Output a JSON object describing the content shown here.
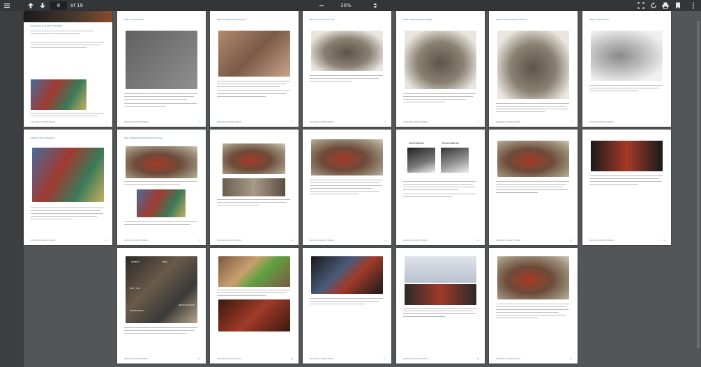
{
  "toolbar": {
    "page_input": "8",
    "page_total": "of 19",
    "zoom": "30%"
  },
  "pages": [
    {
      "title": "Dinosaurs & Creature Painting",
      "footer_left": "CREATURE CONCEPT DESIGN",
      "footer_right": "1"
    },
    {
      "title": "Step 2 Thumbnails",
      "footer_left": "CREATURE CONCEPT DESIGN",
      "footer_right": "2"
    },
    {
      "title": "Step 3 Refining Thumbnails",
      "footer_left": "CREATURE CONCEPT DESIGN",
      "footer_right": "3"
    },
    {
      "title": "Step 4 Choosing a Look",
      "footer_left": "CREATURE CONCEPT DESIGN",
      "footer_right": "4"
    },
    {
      "title": "Step 5 Exploring the Design",
      "footer_left": "CREATURE CONCEPT DESIGN",
      "footer_right": "5"
    },
    {
      "title": "Step 6 Exploring the Anatomy",
      "footer_left": "CREATURE CONCEPT DESIGN",
      "footer_right": "6"
    },
    {
      "title": "Step 7 Other Views",
      "footer_left": "CREATURE CONCEPT DESIGN",
      "footer_right": "7"
    },
    {
      "title": "Step 8 Color Variations",
      "footer_left": "CREATURE CONCEPT DESIGN",
      "footer_right": "8"
    },
    {
      "title": "Step 10 Rendering the Final Concept",
      "footer_left": "CREATURE CONCEPT DESIGN",
      "footer_right": "9"
    },
    {
      "title": "",
      "footer_left": "CREATURE CONCEPT DESIGN",
      "footer_right": "10"
    },
    {
      "title": "",
      "footer_left": "CREATURE CONCEPT DESIGN",
      "footer_right": "11"
    },
    {
      "title": "",
      "footer_left": "CREATURE CONCEPT DESIGN",
      "footer_right": "12"
    },
    {
      "title": "",
      "footer_left": "CREATURE CONCEPT DESIGN",
      "footer_right": "13"
    },
    {
      "title": "",
      "footer_left": "CREATURE CONCEPT DESIGN",
      "footer_right": "14"
    },
    {
      "title": "",
      "footer_left": "CREATURE CONCEPT DESIGN",
      "footer_right": "15"
    },
    {
      "title": "",
      "footer_left": "CREATURE CONCEPT DESIGN",
      "footer_right": "16"
    },
    {
      "title": "",
      "footer_left": "CREATURE CONCEPT DESIGN",
      "footer_right": "17"
    },
    {
      "title": "",
      "footer_left": "CREATURE CONCEPT DESIGN",
      "footer_right": "18"
    },
    {
      "title": "",
      "footer_left": "CREATURE CONCEPT DESIGN",
      "footer_right": "19"
    }
  ],
  "brush_labels": {
    "solid": "SOLID BRUSH",
    "rough": "ROUGH BRUSH"
  },
  "texture_labels": {
    "sketch": "SKETCH",
    "final": "FINAL",
    "soft_top": "SOFT TOP",
    "sharp_edge": "SHARP EDGE",
    "drop_shadow": "DROP SHADOW"
  }
}
